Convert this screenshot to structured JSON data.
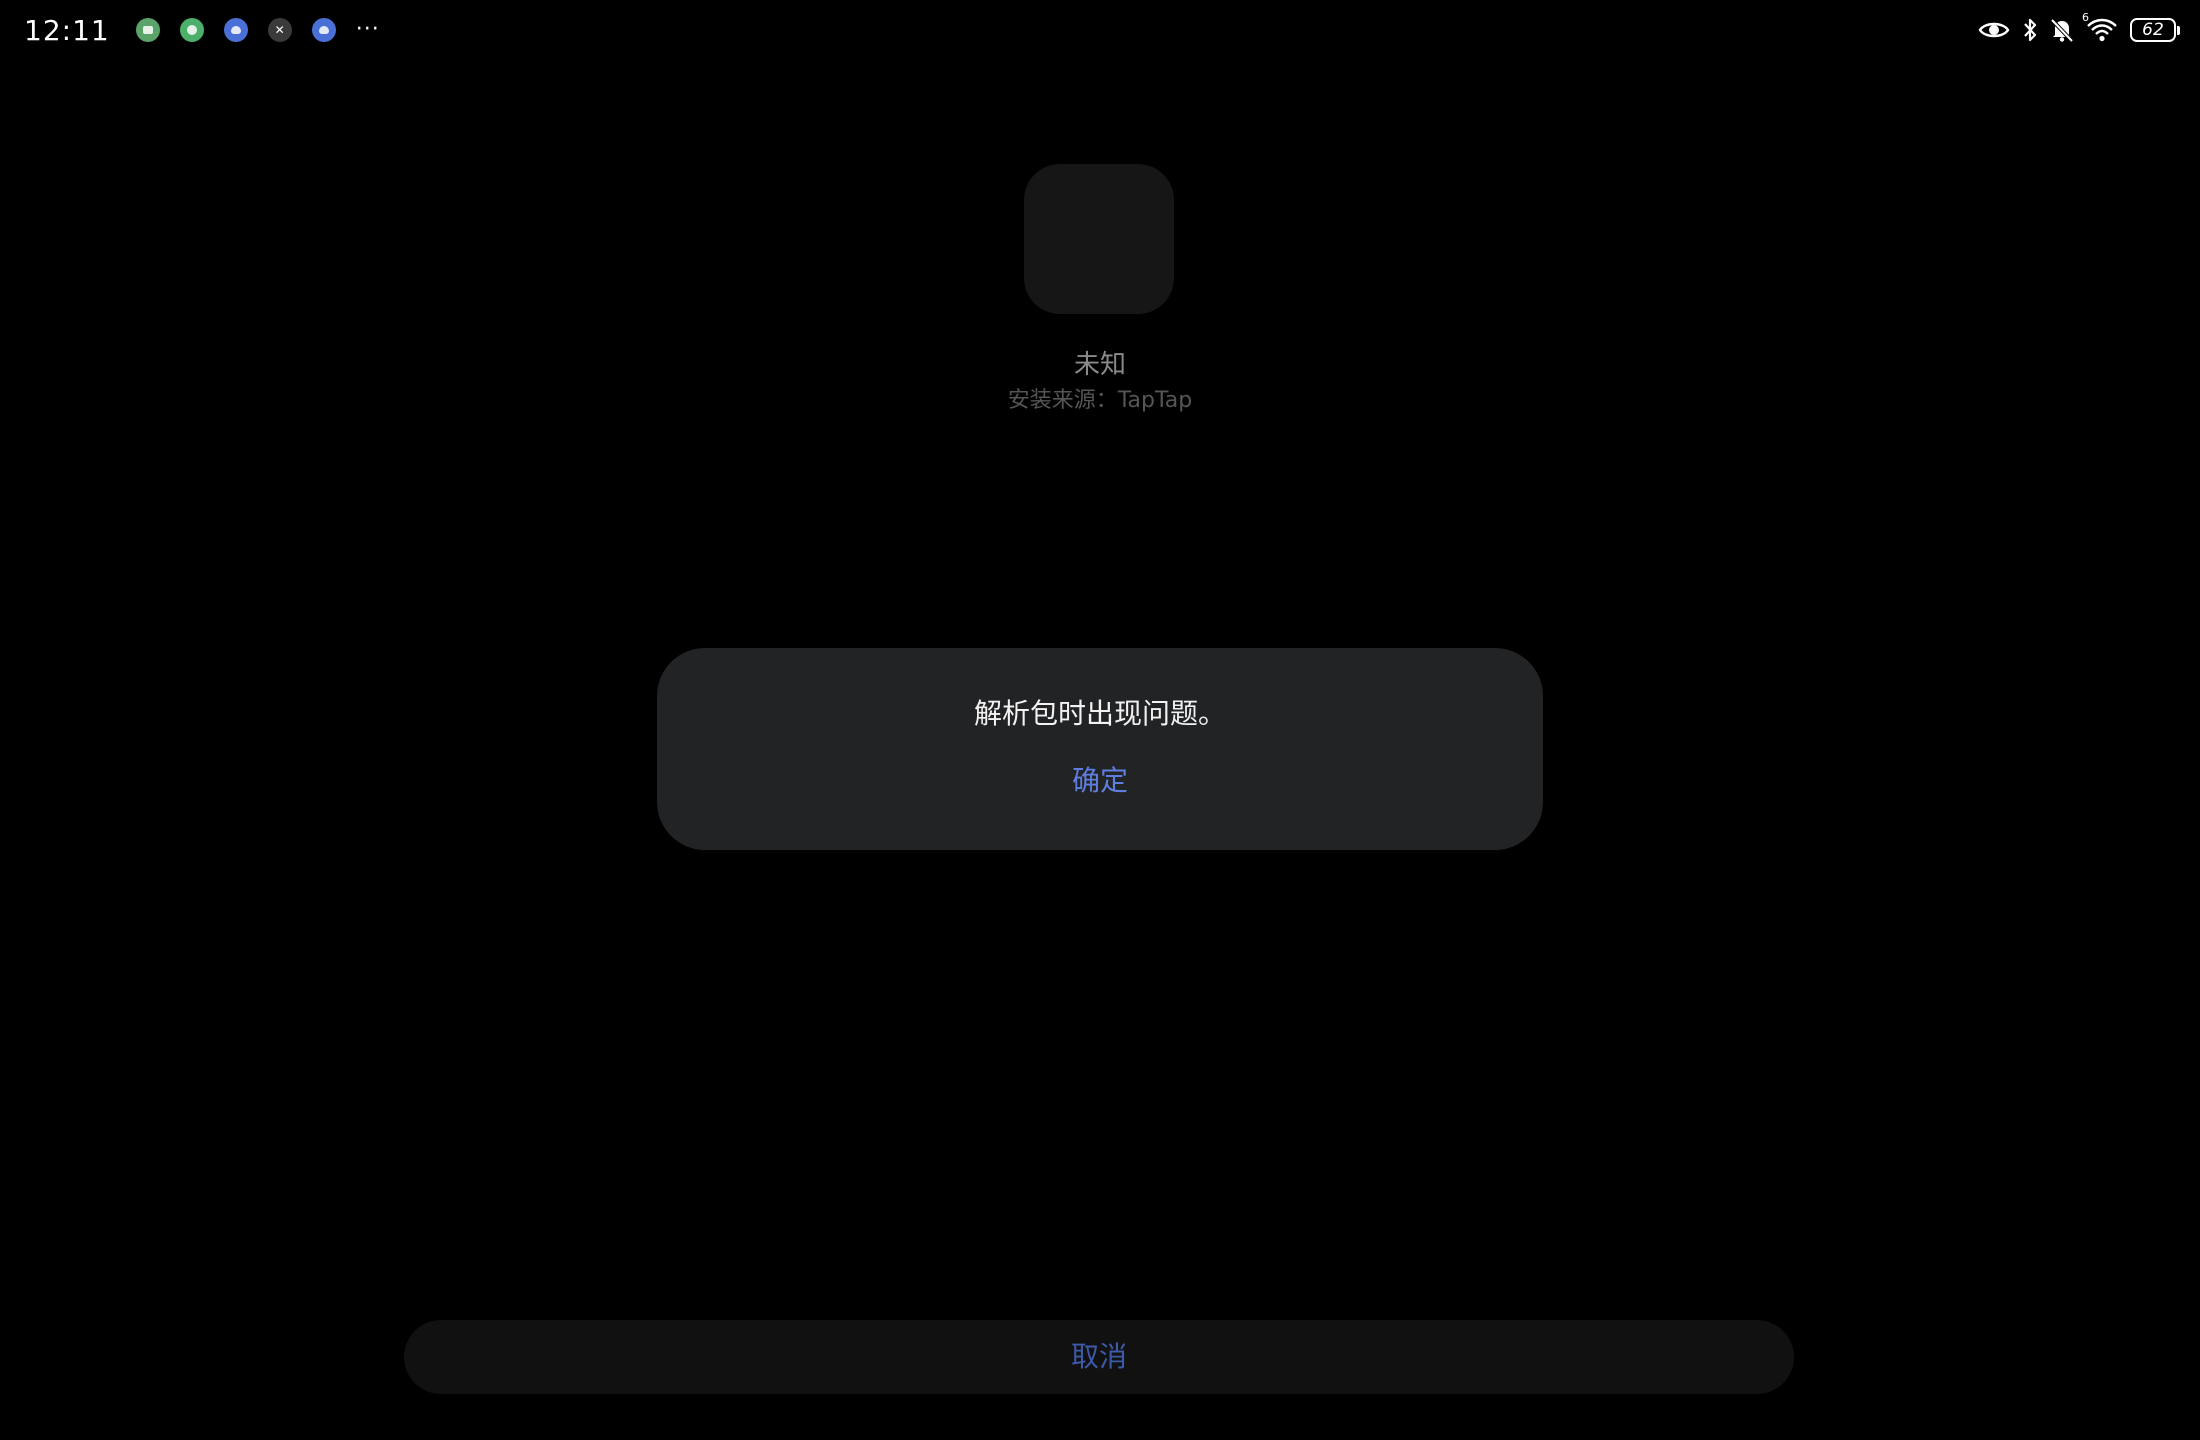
{
  "status_bar": {
    "time": "12:11",
    "notification_icons": [
      {
        "icon": "android-app-icon",
        "color": "#5aa469"
      },
      {
        "icon": "chat-app-icon",
        "color": "#4caf6a"
      },
      {
        "icon": "cloud-app-icon",
        "color": "#4a6fd6"
      },
      {
        "icon": "x-app-icon",
        "color": "#3a3a3a"
      },
      {
        "icon": "cloud-app-icon",
        "color": "#4a6fd6"
      }
    ],
    "more_indicator": "···",
    "right_icons": [
      "eye-icon",
      "bluetooth-icon",
      "mute-bell-icon",
      "wifi-icon"
    ],
    "wifi_label": "6",
    "battery_level": "62"
  },
  "app": {
    "name": "未知",
    "install_source": "安装来源：TapTap"
  },
  "dialog": {
    "message": "解析包时出现问题。",
    "ok_label": "确定"
  },
  "footer": {
    "cancel_label": "取消"
  },
  "colors": {
    "background": "#000000",
    "dialog_bg": "#222325",
    "accent": "#5f7fe0",
    "muted_accent": "#3d5aa8"
  }
}
